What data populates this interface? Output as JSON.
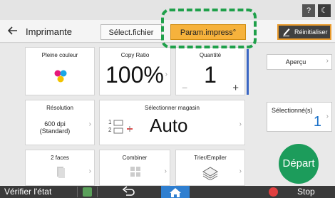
{
  "header": {
    "back_icon": "arrow-left-icon",
    "title": "Imprimante",
    "tabs": [
      {
        "label": "Sélect.fichier",
        "active": false
      },
      {
        "label": "Param.impress°",
        "active": true
      }
    ],
    "reset_label": "Réinitialiser"
  },
  "system": {
    "help_label": "?",
    "moon_label": "☾"
  },
  "cards": {
    "color": {
      "label": "Pleine couleur"
    },
    "copy_ratio": {
      "label": "Copy Ratio",
      "value": "100%"
    },
    "quantity": {
      "label": "Quantité",
      "value": "1",
      "minus": "−",
      "plus": "+"
    },
    "resolution": {
      "label": "Résolution",
      "value_line1": "600 dpi",
      "value_line2": "(Standard)"
    },
    "tray": {
      "label": "Sélectionner magasin",
      "value": "Auto",
      "icon_numbers": [
        "1",
        "2"
      ]
    },
    "duplex": {
      "label": "2 faces"
    },
    "combine": {
      "label": "Combiner"
    },
    "sort": {
      "label": "Trier/Empiler"
    }
  },
  "right_panel": {
    "preview_label": "Aperçu",
    "selected_label": "Sélectionné(s)",
    "selected_count": "1",
    "start_label": "Départ"
  },
  "bottom_bar": {
    "check_status_label": "Vérifier l'état",
    "stop_label": "Stop"
  },
  "colors": {
    "accent": "#f6b23c",
    "highlight": "#1fa04a",
    "start": "#1c9c5b",
    "selected_count": "#1a70c8"
  }
}
